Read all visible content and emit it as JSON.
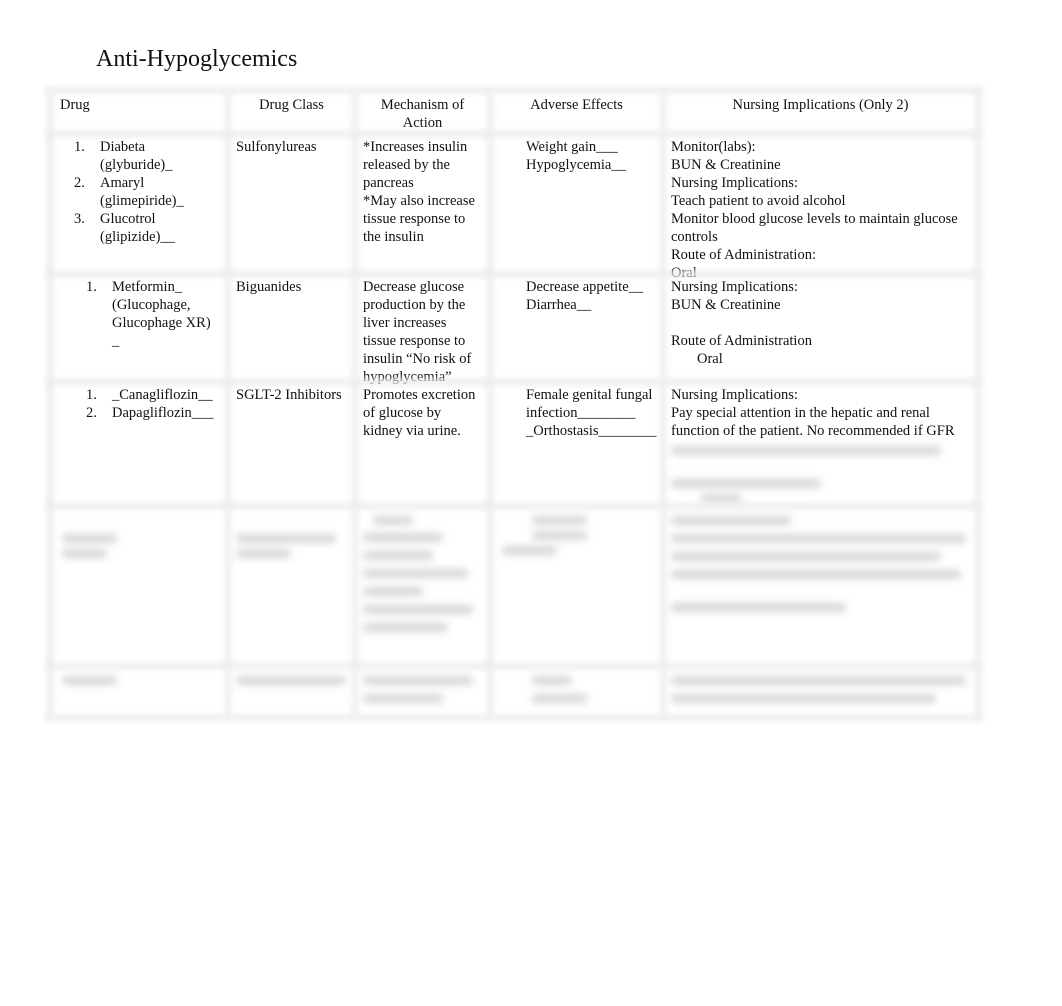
{
  "title": "Anti-Hypoglycemics",
  "table": {
    "headers": {
      "drug": "Drug",
      "drug_class": "Drug Class",
      "mechanism": "Mechanism of Action",
      "adverse": "Adverse Effects",
      "nursing": "Nursing Implications (Only 2)"
    },
    "rows": [
      {
        "drugs": [
          {
            "num": "1.",
            "lines": [
              "Diabeta (glyburide)_"
            ]
          },
          {
            "num": "2.",
            "lines": [
              "Amaryl",
              "(glimepiride)_"
            ]
          },
          {
            "num": "3.",
            "lines": [
              "Glucotrol",
              "(glipizide)__"
            ]
          }
        ],
        "drug_class": "Sulfonylureas",
        "mechanism": [
          "*Increases insulin",
          "released by the",
          "pancreas",
          "*May also increase",
          "tissue response to",
          "the insulin"
        ],
        "adverse": [
          {
            "bullet": "",
            "lines": [
              "Weight gain___"
            ]
          },
          {
            "bullet": "",
            "lines": [
              "Hypoglycemia__"
            ]
          }
        ],
        "nursing": [
          "Monitor(labs):",
          "BUN & Creatinine",
          "Nursing Implications:",
          "Teach patient to avoid alcohol",
          "Monitor blood glucose levels to maintain glucose",
          "controls",
          "Route of Administration:",
          "Oral"
        ]
      },
      {
        "drugs": [
          {
            "num": "1.",
            "lines": [
              "Metformin_",
              "(Glucophage,",
              "Glucophage XR) _"
            ]
          }
        ],
        "drug_class": "Biguanides",
        "mechanism": [
          "Decrease glucose",
          "production by the",
          "liver increases",
          "tissue response to",
          "insulin “No risk of",
          "hypoglycemia”"
        ],
        "adverse": [
          {
            "bullet": "",
            "lines": [
              "Decrease appetite__"
            ]
          },
          {
            "bullet": "",
            "lines": [
              "Diarrhea__"
            ]
          }
        ],
        "nursing": [
          "Nursing Implications:",
          "BUN & Creatinine",
          "",
          "Route of Administration"
        ],
        "nursing_indented": "Oral"
      },
      {
        "drugs": [
          {
            "num": "1.",
            "lines": [
              "_Canagliflozin__"
            ]
          },
          {
            "num": "2.",
            "lines": [
              "Dapagliflozin___"
            ]
          }
        ],
        "drug_class": "SGLT-2 Inhibitors",
        "mechanism": [
          "Promotes excretion",
          "of glucose by",
          "kidney via urine."
        ],
        "adverse": [
          {
            "bullet": "",
            "lines": [
              "Female genital fungal",
              "infection________"
            ]
          },
          {
            "bullet": "",
            "lines": [
              "_Orthostasis________"
            ]
          }
        ],
        "nursing": [
          "Nursing Implications:",
          "Pay special attention in the hepatic and renal",
          "function of the patient. No recommended if GFR"
        ]
      }
    ]
  }
}
